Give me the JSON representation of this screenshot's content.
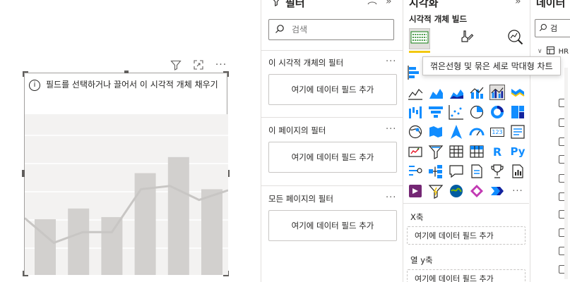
{
  "visual": {
    "hint": "필드를 선택하거나 끌어서 이 시각적 개체 채우기",
    "info_glyph": "i",
    "header_icons": [
      "filter-icon",
      "focus-mode-icon",
      "more-options-icon"
    ],
    "more_glyph": "···",
    "placeholder_chart": {
      "type": "bar-line-combo",
      "bar_values": [
        0.52,
        0.62,
        0.54,
        0.95,
        1.1,
        0.8
      ],
      "line_values": [
        0.53,
        0.3,
        0.4,
        0.4,
        0.8,
        0.83,
        0.7,
        0.79
      ],
      "y_max": 1.25
    }
  },
  "filters": {
    "title": "필터",
    "search_placeholder": "검색",
    "sections": [
      {
        "label": "이 시각적 개체의 필터",
        "drop": "여기에 데이터 필드 추가"
      },
      {
        "label": "이 페이지의 필터",
        "drop": "여기에 데이터 필드 추가"
      },
      {
        "label": "모든 페이지의 필터",
        "drop": "여기에 데이터 필드 추가"
      }
    ],
    "more_glyph": "···"
  },
  "viz": {
    "title": "시각화",
    "build_label": "시각적 개체 빌드",
    "tooltip": "꺾은선형 및 묶은 세로 막대형 차트",
    "wells": [
      {
        "label": "X축",
        "drop": "여기에 데이터 필드 추가"
      },
      {
        "label": "열 y축",
        "drop": "여기에 데이터 필드 추가"
      }
    ],
    "r_glyph": "R",
    "py_glyph": "Py",
    "num_glyph": "123",
    "more_glyph": "···"
  },
  "data": {
    "title": "데이터",
    "search_placeholder": "검",
    "table_label": "HR"
  },
  "colors": {
    "accent": "#f2c811",
    "selected_border": "#605e5c",
    "placeholder_bar": "#d2d0ce",
    "icon_blue": "#118dff",
    "icon_dark": "#252423"
  }
}
